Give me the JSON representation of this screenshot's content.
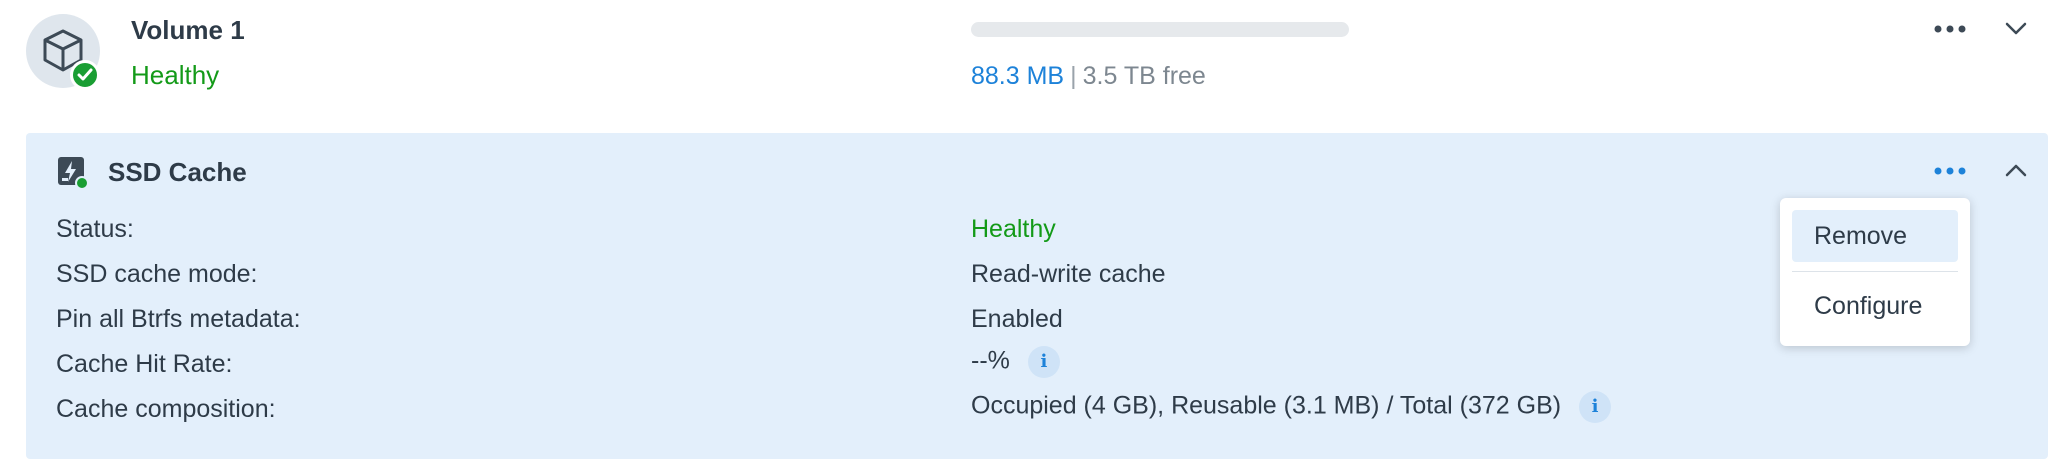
{
  "volume": {
    "title": "Volume 1",
    "status": "Healthy",
    "used": "88.3 MB",
    "separator": "|",
    "free": "3.5 TB free",
    "usage_fraction": 0.0,
    "icon": "cube-icon",
    "status_icon": "check-circle-icon"
  },
  "cache": {
    "title": "SSD Cache",
    "icon": "ssd-cache-icon",
    "rows": [
      {
        "label": "Status:",
        "value": "Healthy"
      },
      {
        "label": "SSD cache mode:",
        "value": "Read-write cache"
      },
      {
        "label": "Pin all Btrfs metadata:",
        "value": "Enabled"
      },
      {
        "label": "Cache Hit Rate:",
        "value": "--%"
      },
      {
        "label": "Cache composition:",
        "value": "Occupied (4 GB), Reusable (3.1 MB) / Total (372 GB)"
      }
    ]
  },
  "menu": {
    "items": [
      "Remove",
      "Configure"
    ]
  },
  "colors": {
    "healthy": "#139a18",
    "accent": "#1d82d9",
    "panel_bg": "#e3effb"
  }
}
